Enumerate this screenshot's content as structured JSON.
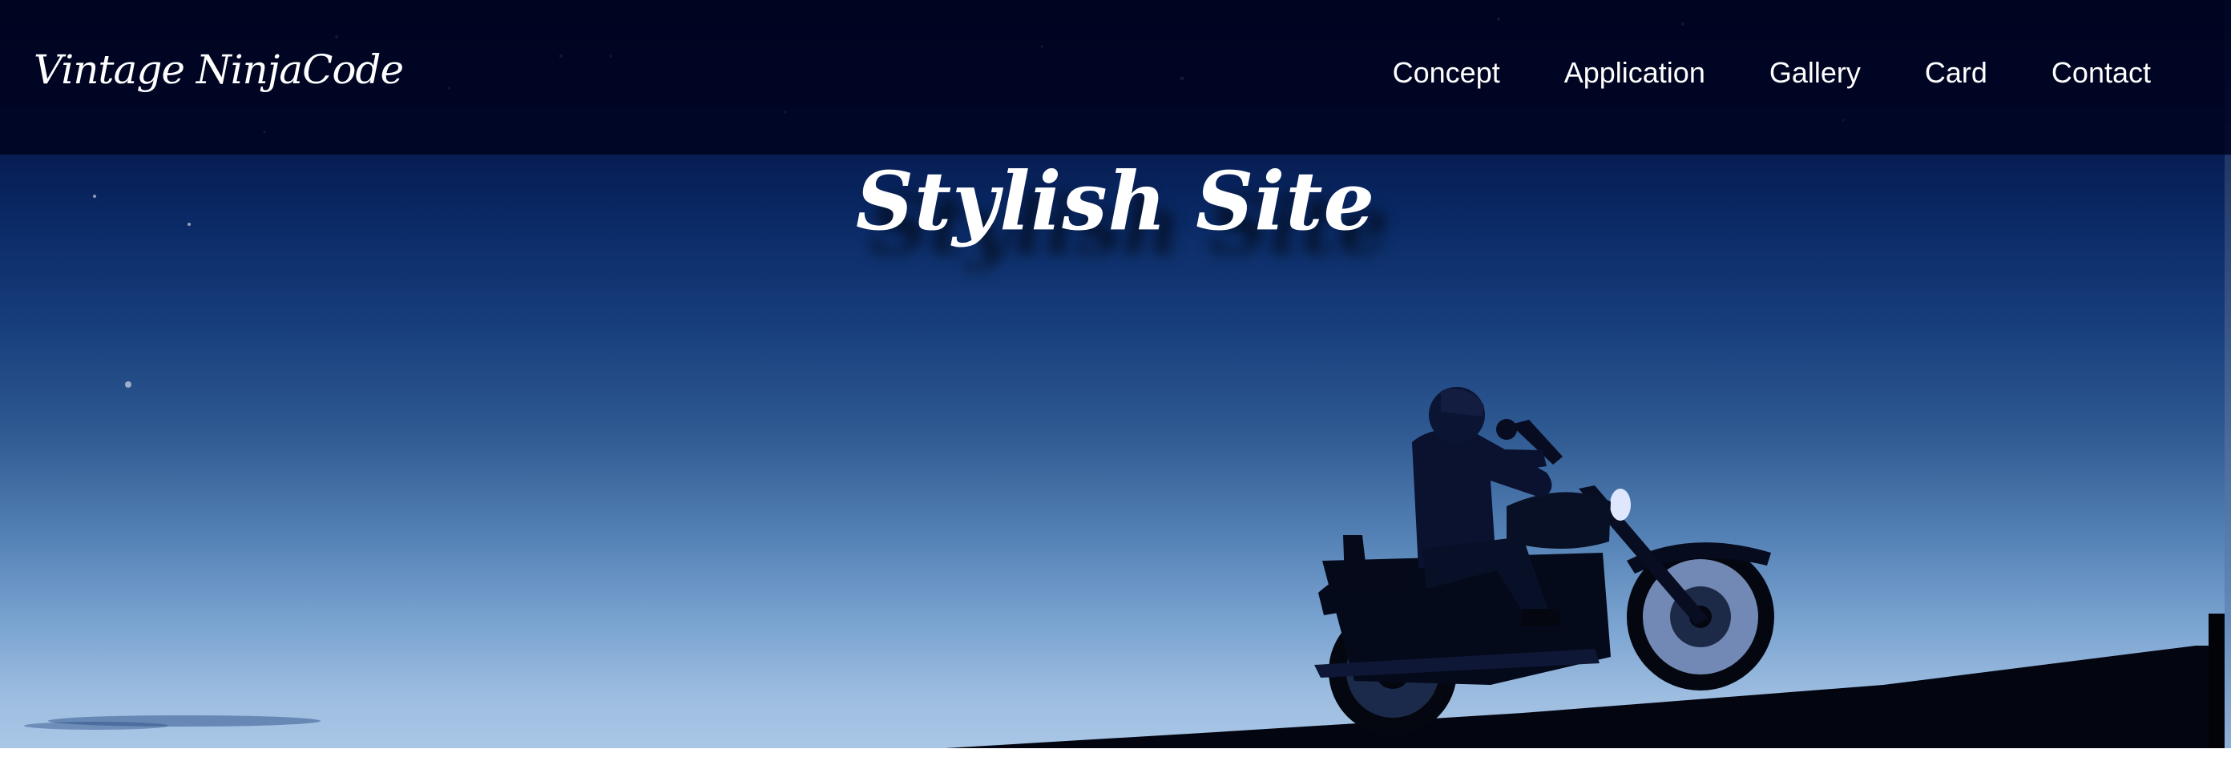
{
  "header": {
    "logo": "Vintage NinjaCode",
    "nav_items": [
      "Concept",
      "Application",
      "Gallery",
      "Card",
      "Contact"
    ]
  },
  "hero": {
    "title": "Stylish Site",
    "image_subject": "motorcyclist-silhouette-at-dusk"
  },
  "colors": {
    "nav_background": "#000320",
    "sky_top": "#020a2a",
    "sky_bottom": "#a9c6e6",
    "text": "#ffffff"
  }
}
